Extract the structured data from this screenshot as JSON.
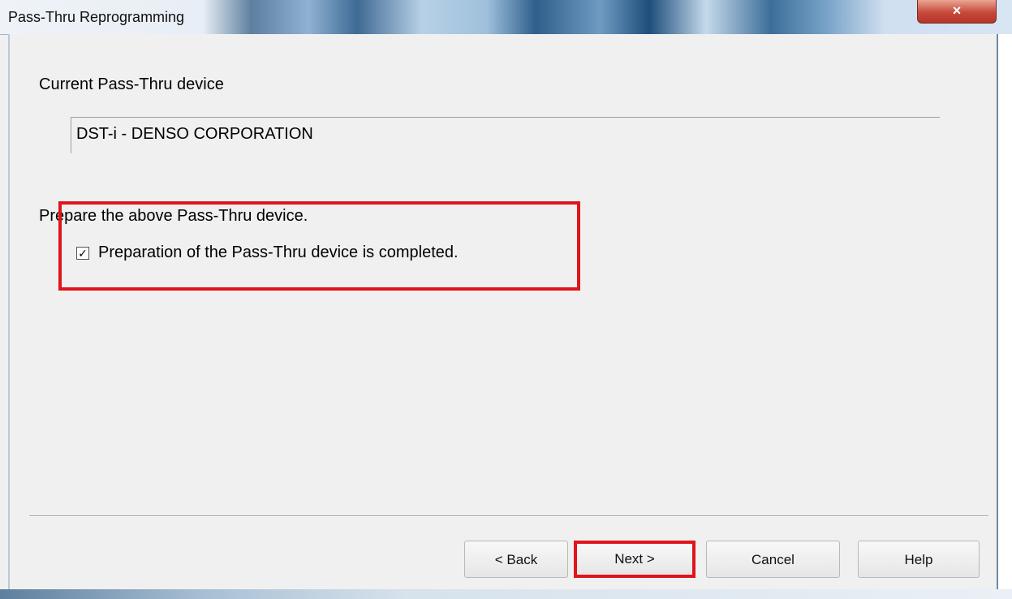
{
  "window": {
    "title": "Pass-Thru Reprogramming",
    "close_symbol": "×",
    "close_icon": "close-icon"
  },
  "main": {
    "current_device_label": "Current Pass-Thru device",
    "current_device_value": "DST-i - DENSO CORPORATION",
    "prepare_text": "Prepare the above Pass-Thru device.",
    "checkbox": {
      "label": "Preparation of the Pass-Thru device is completed.",
      "checked": true,
      "check_mark": "✓"
    }
  },
  "buttons": {
    "back": "< Back",
    "next": "Next >",
    "cancel": "Cancel",
    "help": "Help"
  },
  "colors": {
    "highlight": "#e0141c",
    "dialog_bg": "#f0f0f0"
  }
}
